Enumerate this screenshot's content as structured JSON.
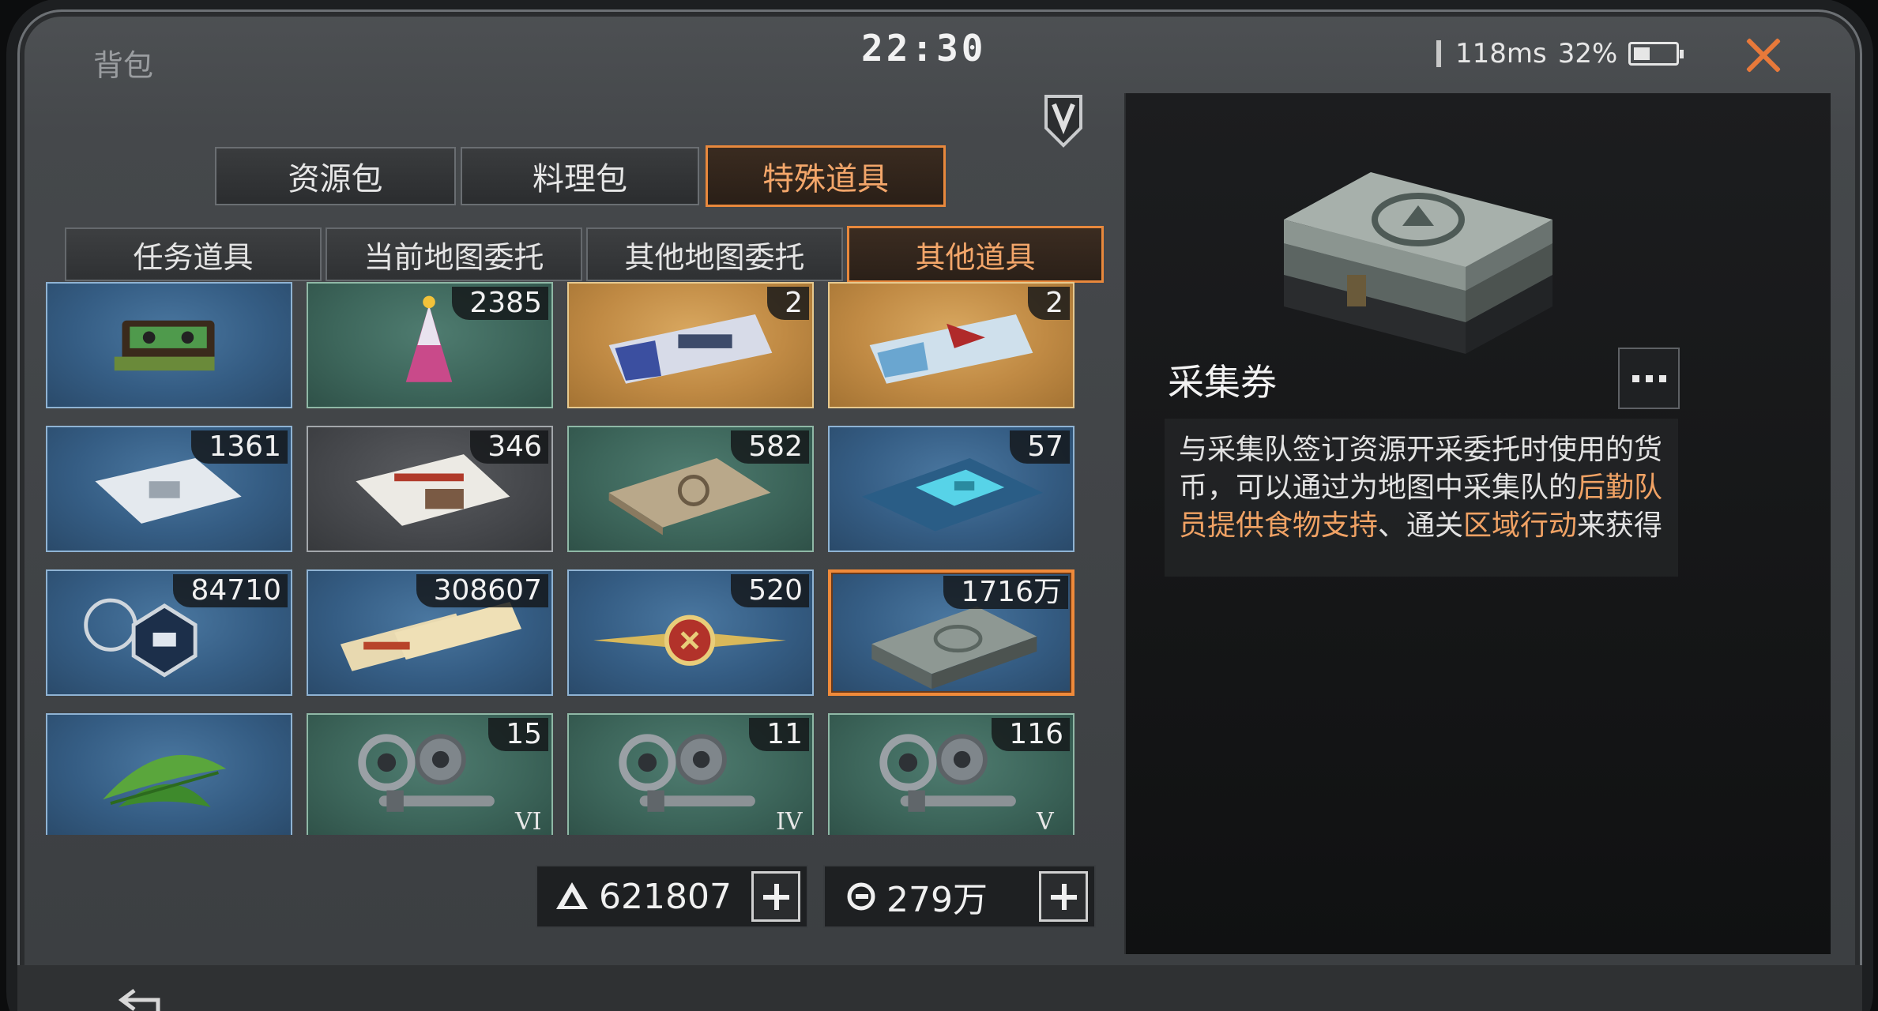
{
  "header": {
    "title": "背包",
    "clock": "22:30",
    "ping": "118ms",
    "battery": "32%"
  },
  "tabs": [
    {
      "label": "资源包",
      "active": false
    },
    {
      "label": "料理包",
      "active": false
    },
    {
      "label": "特殊道具",
      "active": true
    }
  ],
  "subtabs": [
    {
      "label": "任务道具",
      "active": false
    },
    {
      "label": "当前地图委托",
      "active": false
    },
    {
      "label": "其他地图委托",
      "active": false
    },
    {
      "label": "其他道具",
      "active": true
    }
  ],
  "items": [
    {
      "icon": "cassette-tape-icon",
      "count": "",
      "bg": "blue"
    },
    {
      "icon": "party-hat-icon",
      "count": "2385",
      "bg": "green"
    },
    {
      "icon": "ticket-helicopter-icon",
      "count": "2",
      "bg": "gold"
    },
    {
      "icon": "ticket-aircraft-icon",
      "count": "2",
      "bg": "gold"
    },
    {
      "icon": "sealed-bag-icon",
      "count": "1361",
      "bg": "blue"
    },
    {
      "icon": "newspaper-icon",
      "count": "346",
      "bg": "gray"
    },
    {
      "icon": "document-stack-icon",
      "count": "582",
      "bg": "green"
    },
    {
      "icon": "circuit-board-icon",
      "count": "57",
      "bg": "blue"
    },
    {
      "icon": "dog-tag-icon",
      "count": "84710",
      "bg": "blue"
    },
    {
      "icon": "movie-ticket-icon",
      "count": "308607",
      "bg": "blue"
    },
    {
      "icon": "wing-badge-icon",
      "count": "520",
      "bg": "blue"
    },
    {
      "icon": "cash-stack-icon",
      "count": "1716万",
      "bg": "blue",
      "selected": true
    },
    {
      "icon": "herb-leaf-icon",
      "count": "",
      "bg": "blue"
    },
    {
      "icon": "gear-parts-icon",
      "count": "15",
      "bg": "green",
      "tier": "VI"
    },
    {
      "icon": "gear-parts-icon",
      "count": "11",
      "bg": "green",
      "tier": "IV"
    },
    {
      "icon": "gear-parts-icon",
      "count": "116",
      "bg": "green",
      "tier": "V"
    }
  ],
  "currency": [
    {
      "icon": "crystal-icon",
      "value": "621807"
    },
    {
      "icon": "coin-icon",
      "value": "279万"
    }
  ],
  "detail": {
    "name": "采集券",
    "desc_parts": [
      {
        "text": "与采集队签订资源开采委托时使用的货币，可以通过为地图中采集队的",
        "hl": false
      },
      {
        "text": "后勤队员提供食物支持",
        "hl": true
      },
      {
        "text": "、通关",
        "hl": false
      },
      {
        "text": "区域行动",
        "hl": true
      },
      {
        "text": "来获得",
        "hl": false
      }
    ]
  },
  "colors": {
    "accent": "#e8883c",
    "highlight": "#f0a264",
    "close": "#e8793a"
  }
}
